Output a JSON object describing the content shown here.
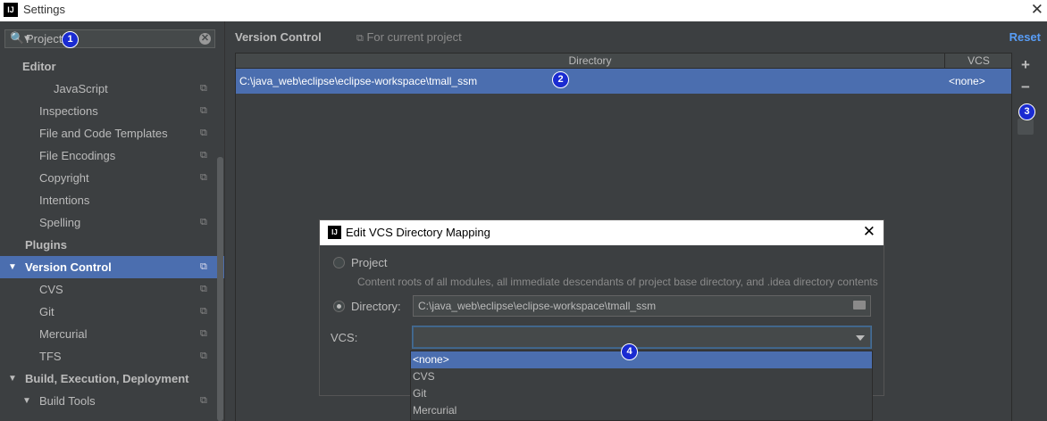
{
  "window": {
    "title": "Settings",
    "app_icon": "intellij-icon",
    "close_glyph": "✕"
  },
  "search": {
    "value": "Project",
    "mag_glyph": "🔍▾",
    "clear_glyph": "✕"
  },
  "sidebar": {
    "items": [
      {
        "label": "Editor",
        "indent": "a",
        "bold": true,
        "arrow": "",
        "copy": false
      },
      {
        "label": "JavaScript",
        "indent": "d",
        "bold": false,
        "arrow": "",
        "copy": true
      },
      {
        "label": "Inspections",
        "indent": "c",
        "bold": false,
        "arrow": "",
        "copy": true
      },
      {
        "label": "File and Code Templates",
        "indent": "c",
        "bold": false,
        "arrow": "",
        "copy": true
      },
      {
        "label": "File Encodings",
        "indent": "c",
        "bold": false,
        "arrow": "",
        "copy": true
      },
      {
        "label": "Copyright",
        "indent": "c",
        "bold": false,
        "arrow": "",
        "copy": true
      },
      {
        "label": "Intentions",
        "indent": "c",
        "bold": false,
        "arrow": "",
        "copy": false
      },
      {
        "label": "Spelling",
        "indent": "c",
        "bold": false,
        "arrow": "",
        "copy": true
      },
      {
        "label": "Plugins",
        "indent": "b",
        "bold": true,
        "arrow": "",
        "copy": false
      },
      {
        "label": "Version Control",
        "indent": "b",
        "bold": true,
        "arrow": "▼",
        "copy": true,
        "selected": true
      },
      {
        "label": "CVS",
        "indent": "c",
        "bold": false,
        "arrow": "",
        "copy": true
      },
      {
        "label": "Git",
        "indent": "c",
        "bold": false,
        "arrow": "",
        "copy": true
      },
      {
        "label": "Mercurial",
        "indent": "c",
        "bold": false,
        "arrow": "",
        "copy": true
      },
      {
        "label": "TFS",
        "indent": "c",
        "bold": false,
        "arrow": "",
        "copy": true
      },
      {
        "label": "Build, Execution, Deployment",
        "indent": "b",
        "bold": true,
        "arrow": "▼",
        "copy": false
      },
      {
        "label": "Build Tools",
        "indent": "c",
        "bold": false,
        "arrow": "▼",
        "copy": true
      }
    ]
  },
  "main": {
    "title": "Version Control",
    "scope": "For current project",
    "reset": "Reset",
    "table": {
      "headers": [
        "Directory",
        "VCS"
      ],
      "rows": [
        {
          "directory": "C:\\java_web\\eclipse\\eclipse-workspace\\tmall_ssm",
          "vcs": "<none>"
        }
      ]
    },
    "tools": {
      "add": "+",
      "remove": "−"
    }
  },
  "dialog": {
    "title": "Edit VCS Directory Mapping",
    "close_glyph": "✕",
    "project_label": "Project",
    "project_desc": "Content roots of all modules, all immediate descendants of project base directory, and .idea directory contents",
    "directory_label": "Directory:",
    "directory_value": "C:\\java_web\\eclipse\\eclipse-workspace\\tmall_ssm",
    "vcs_label": "VCS:",
    "vcs_value": "",
    "selected_option": "Directory"
  },
  "dropdown": {
    "options": [
      "<none>",
      "CVS",
      "Git",
      "Mercurial"
    ],
    "selected": "<none>"
  },
  "badges": [
    "1",
    "2",
    "3",
    "4"
  ],
  "colors": {
    "selection": "#4b6eaf",
    "link": "#589df6",
    "badge": "#1a2bd1",
    "background": "#3c3f41"
  }
}
